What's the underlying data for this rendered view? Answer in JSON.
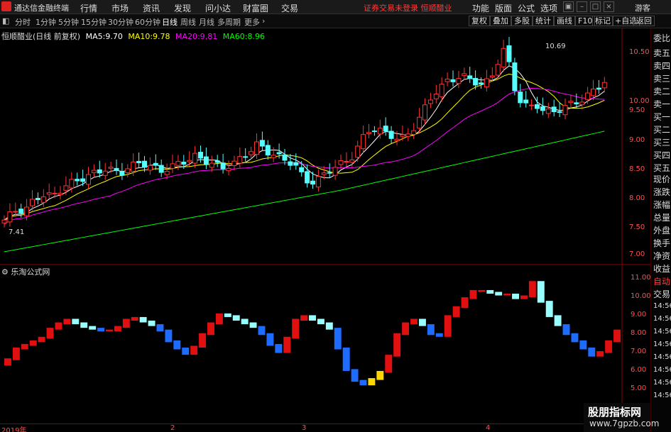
{
  "menubar": {
    "app_title": "通达信金融终端",
    "items": [
      "行情",
      "市场",
      "资讯",
      "发现",
      "问小达",
      "财富圈",
      "交易"
    ],
    "notice": "证券交易未登录 恒顺醋业",
    "right_items": [
      "功能",
      "版面",
      "公式",
      "选项"
    ],
    "guest": "游客"
  },
  "toolbar": {
    "periods": [
      "分时",
      "1分钟",
      "5分钟",
      "15分钟",
      "30分钟",
      "60分钟",
      "日线",
      "周线",
      "月线",
      "多周期",
      "更多"
    ],
    "active_period": "日线",
    "buttons": [
      "复权",
      "叠加",
      "多股",
      "统计",
      "画线",
      "F10",
      "标记",
      "+自选",
      "返回"
    ]
  },
  "main_chart": {
    "stock_label": "恒顺醋业(日线 前复权)",
    "ma": [
      {
        "name": "MA5:",
        "value": "9.70",
        "color": "#ffffff"
      },
      {
        "name": "MA10:",
        "value": "9.78",
        "color": "#ffff00"
      },
      {
        "name": "MA20:",
        "value": "9.81",
        "color": "#ff00ff"
      },
      {
        "name": "MA60:",
        "value": "8.96",
        "color": "#00ff00"
      }
    ],
    "high_marker": "10.69",
    "low_marker": "7.41",
    "price_ticks": [
      "10.50",
      "10.00",
      "9.50",
      "9.00",
      "8.50",
      "8.00",
      "7.50",
      "7.00"
    ]
  },
  "indicator": {
    "title": "乐淘公式网",
    "ticks": [
      "11.00",
      "10.00",
      "9.00",
      "8.00",
      "7.00",
      "6.00",
      "5.00"
    ]
  },
  "date_axis": [
    "2019年",
    "2",
    "3",
    "4"
  ],
  "right_panel": {
    "items": [
      "委比",
      "卖五",
      "卖四",
      "卖三",
      "卖二",
      "卖一",
      "买一",
      "买二",
      "买三",
      "买四",
      "买五",
      "现价",
      "涨跌",
      "涨幅",
      "总量",
      "外盘",
      "换手",
      "净资",
      "收益"
    ],
    "bottom_items": [
      "自动",
      "交易"
    ],
    "times": [
      "14:56",
      "14:56",
      "14:56",
      "14:56",
      "14:56",
      "14:56",
      "14:56",
      "14:56"
    ]
  },
  "watermark": {
    "line1": "股朋指标网",
    "line2": "www.7gpzb.com"
  },
  "colors": {
    "up": "#ff3232",
    "down": "#54ffff",
    "ind_up": "#e01010",
    "ind_down_light": "#9ff",
    "ind_down_blue": "#1e6bff",
    "ind_yellow": "#ffd700"
  }
}
